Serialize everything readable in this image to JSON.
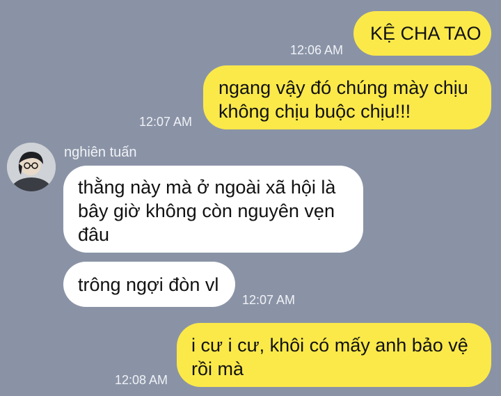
{
  "messages": [
    {
      "text": "KỆ CHA TAO",
      "time": "12:06 AM"
    },
    {
      "text": "ngang vậy đó chúng mày chịu\nkhông chịu buộc chịu!!!",
      "time": "12:07 AM"
    },
    {
      "sender": "nghiên tuấn",
      "text": "thằng này mà ở ngoài xã hội là\nbây giờ không còn nguyên vẹn\nđâu"
    },
    {
      "text": "trông ngợi đòn vl",
      "time": "12:07 AM"
    },
    {
      "text": "i cư i cư, khôi có mấy anh bảo vệ\nrồi mà",
      "time": "12:08 AM"
    }
  ],
  "colors": {
    "background": "#8a93a6",
    "outgoing_bubble": "#fbe94a",
    "incoming_bubble": "#ffffff",
    "meta_text": "#f0f2f6"
  },
  "avatar_icon": "user-avatar-photo"
}
